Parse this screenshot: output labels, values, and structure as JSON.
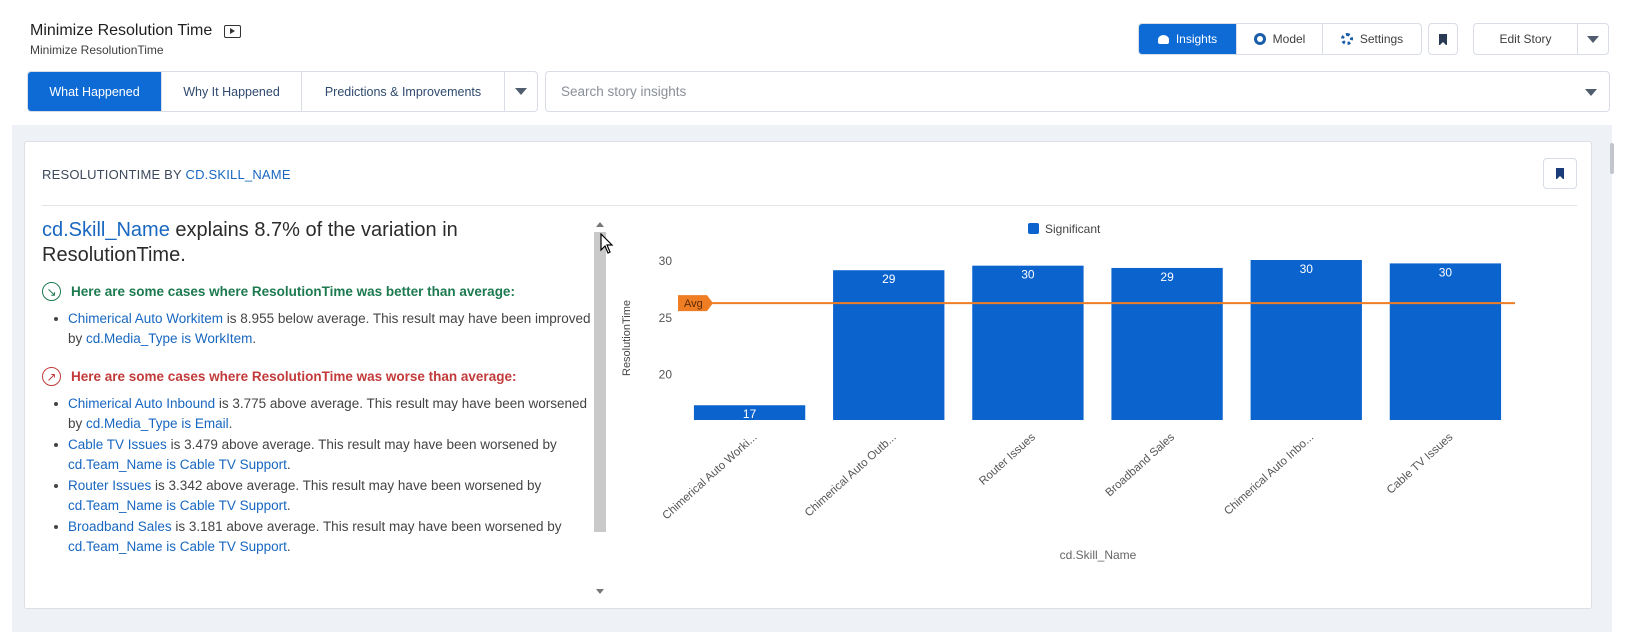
{
  "story": {
    "title": "Minimize Resolution Time",
    "subtitle": "Minimize ResolutionTime"
  },
  "toolbar": {
    "insights_label": "Insights",
    "model_label": "Model",
    "settings_label": "Settings",
    "edit_story_label": "Edit Story"
  },
  "tabs": [
    {
      "label": "What Happened",
      "active": true
    },
    {
      "label": "Why It Happened",
      "active": false
    },
    {
      "label": "Predictions & Improvements",
      "active": false
    }
  ],
  "search": {
    "placeholder": "Search story insights"
  },
  "card": {
    "title_prefix": "RESOLUTIONTIME BY",
    "title_field": "CD.SKILL_NAME"
  },
  "narrative": {
    "headline_field": "cd.Skill_Name",
    "headline_rest": " explains 8.7% of the variation in ResolutionTime.",
    "better_heading": "Here are some cases where ResolutionTime was better than average:",
    "worse_heading": "Here are some cases where ResolutionTime was worse than average:",
    "better_items": [
      {
        "name": "Chimerical Auto Workitem",
        "text": " is 8.955 below average. This result may have been improved by ",
        "cond": "cd.Media_Type is WorkItem",
        "end": "."
      }
    ],
    "worse_items": [
      {
        "name": "Chimerical Auto Inbound",
        "text": " is 3.775 above average. This result may have been worsened by ",
        "cond": "cd.Media_Type is Email",
        "end": "."
      },
      {
        "name": "Cable TV Issues",
        "text": " is 3.479 above average. This result may have been worsened by ",
        "cond": "cd.Team_Name is Cable TV Support",
        "end": "."
      },
      {
        "name": "Router Issues",
        "text": " is 3.342 above average. This result may have been worsened by ",
        "cond": "cd.Team_Name is Cable TV Support",
        "end": "."
      },
      {
        "name": "Broadband Sales",
        "text": " is 3.181 above average. This result may have been worsened by ",
        "cond": "cd.Team_Name is Cable TV Support",
        "end": "."
      }
    ]
  },
  "colors": {
    "accent": "#0e6bd6",
    "bar": "#0b63ce",
    "avg_line": "#ef7d24",
    "better": "#1d7a4f",
    "worse": "#c23a3a"
  },
  "chart_data": {
    "type": "bar",
    "categories": [
      "Chimerical Auto Worki...",
      "Chimerical Auto Outb...",
      "Router Issues",
      "Broadband Sales",
      "Chimerical Auto Inbo...",
      "Cable TV Issues"
    ],
    "series": [
      {
        "name": "Significant",
        "values": [
          17.3,
          29.2,
          29.6,
          29.4,
          30.1,
          29.8
        ],
        "labels": [
          "17",
          "29",
          "30",
          "29",
          "30",
          "30"
        ]
      }
    ],
    "avg": 26.3,
    "avg_label": "Avg",
    "xlabel": "cd.Skill_Name",
    "ylabel": "ResolutionTime",
    "yticks": [
      20,
      25,
      30
    ],
    "ylim": [
      16,
      30.1
    ],
    "legend": "top-center"
  }
}
